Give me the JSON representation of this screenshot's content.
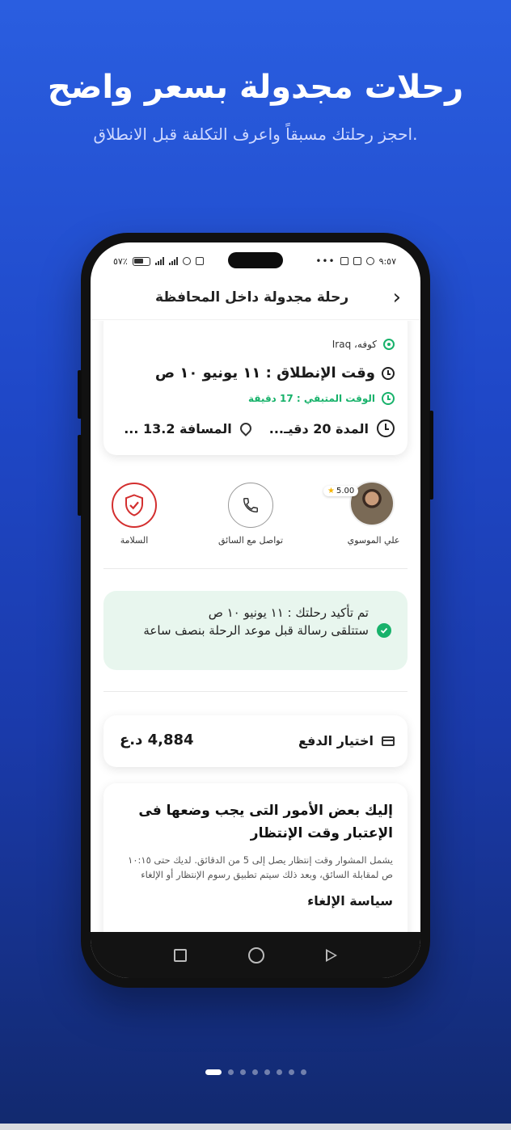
{
  "promo": {
    "title": "رحلات مجدولة بسعر واضح",
    "subtitle": "احجز رحلتك مسبقاً واعرف التكلفة قبل الانطلاق."
  },
  "status_bar": {
    "time": "٩:٥٧",
    "battery": "٥٧٪"
  },
  "header": {
    "title": "رحلة مجدولة داخل المحافظة",
    "back_icon": "chevron-right-icon"
  },
  "trip": {
    "location": "كوفه، Iraq",
    "departure": "وقت الإنطلاق : ١١ يونيو ١٠ ص",
    "remaining": "الوقت المتبقي : 17 دقيقة",
    "duration": "المدة 20 دقيـ...",
    "distance": "المسافة 13.2 ..."
  },
  "actions": {
    "driver_name": "علي الموسوي",
    "rating": "5.00",
    "contact_label": "تواصل مع السائق",
    "safety_label": "السلامة"
  },
  "confirmation": {
    "line1": "تم تأكيد رحلتك : ١١ يونيو ١٠ ص",
    "line2": "ستتلقى رسالة قبل موعد الرحلة بنصف ساعة"
  },
  "payment": {
    "label": "اختيار الدفع",
    "amount": "4,884 د.ع"
  },
  "info": {
    "heading": "إليك بعض الأمور التى يجب وضعها فى الإعتبار وقت الإنتظار",
    "body": "يشمل المشوار وقت إنتظار يصل إلى 5 من الدقائق. لديك حتى ١٠:١٥ ص لمقابلة السائق، وبعد ذلك سيتم تطبيق رسوم الإنتظار أو الإلغاء",
    "policy_title": "سياسة الإلغاء"
  },
  "pager": {
    "count": 8,
    "active_index": 0
  },
  "colors": {
    "accent_green": "#18b26b",
    "safety_red": "#d32f2f",
    "background_blue": "#1f48c8"
  }
}
